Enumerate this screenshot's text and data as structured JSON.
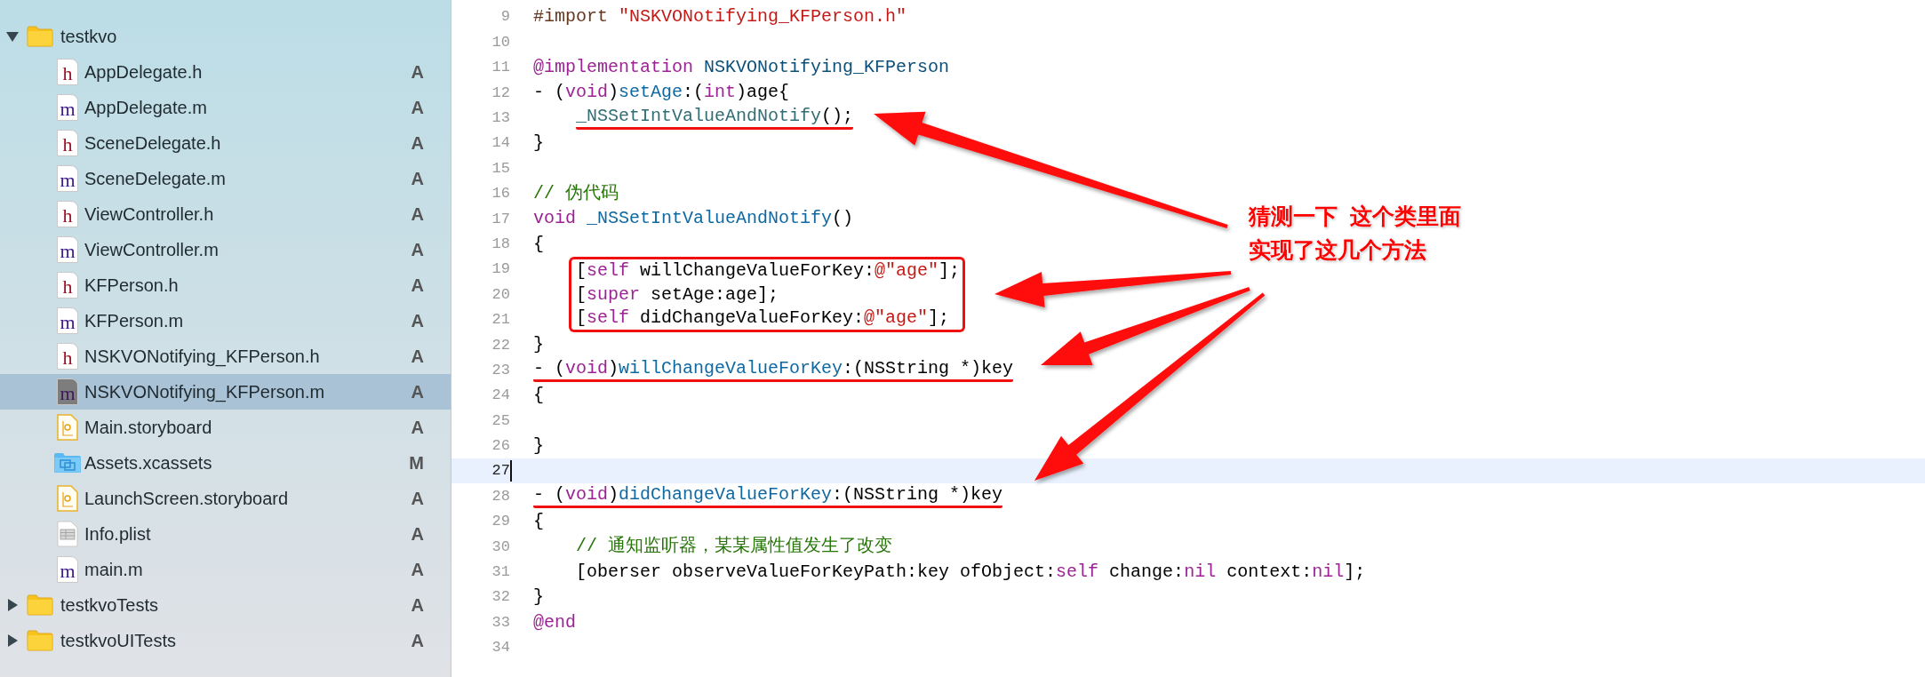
{
  "sidebar": {
    "items": [
      {
        "kind": "folder",
        "name": "testkvo",
        "expanded": true,
        "selected": false,
        "children": [
          {
            "kind": "header",
            "icon_text": "h",
            "name": "AppDelegate.h",
            "badge": "A",
            "selected": false
          },
          {
            "kind": "source",
            "icon_text": "m",
            "name": "AppDelegate.m",
            "badge": "A",
            "selected": false
          },
          {
            "kind": "header",
            "icon_text": "h",
            "name": "SceneDelegate.h",
            "badge": "A",
            "selected": false
          },
          {
            "kind": "source",
            "icon_text": "m",
            "name": "SceneDelegate.m",
            "badge": "A",
            "selected": false
          },
          {
            "kind": "header",
            "icon_text": "h",
            "name": "ViewController.h",
            "badge": "A",
            "selected": false
          },
          {
            "kind": "source",
            "icon_text": "m",
            "name": "ViewController.m",
            "badge": "A",
            "selected": false
          },
          {
            "kind": "header",
            "icon_text": "h",
            "name": "KFPerson.h",
            "badge": "A",
            "selected": false
          },
          {
            "kind": "source",
            "icon_text": "m",
            "name": "KFPerson.m",
            "badge": "A",
            "selected": false
          },
          {
            "kind": "header",
            "icon_text": "h",
            "name": "NSKVONotifying_KFPerson.h",
            "badge": "A",
            "selected": false
          },
          {
            "kind": "source",
            "icon_text": "m",
            "name": "NSKVONotifying_KFPerson.m",
            "badge": "A",
            "selected": true
          },
          {
            "kind": "storyboard",
            "name": "Main.storyboard",
            "badge": "A",
            "selected": false
          },
          {
            "kind": "assets",
            "name": "Assets.xcassets",
            "badge": "M",
            "selected": false
          },
          {
            "kind": "storyboard",
            "name": "LaunchScreen.storyboard",
            "badge": "A",
            "selected": false
          },
          {
            "kind": "plist",
            "name": "Info.plist",
            "badge": "A",
            "selected": false
          },
          {
            "kind": "source",
            "icon_text": "m",
            "name": "main.m",
            "badge": "A",
            "selected": false
          }
        ]
      },
      {
        "kind": "folder",
        "name": "testkvoTests",
        "badge": "A",
        "expanded": false,
        "selected": false
      },
      {
        "kind": "folder",
        "name": "testkvoUITests",
        "badge": "A",
        "expanded": false,
        "selected": false
      }
    ]
  },
  "editor": {
    "lines": [
      {
        "number": "9",
        "current": false,
        "indented": false,
        "tokens": [
          {
            "kind": "directive",
            "text": "#import "
          },
          {
            "kind": "string",
            "text": "\"NSKVONotifying_KFPerson.h\""
          }
        ]
      },
      {
        "number": "10",
        "current": false
      },
      {
        "number": "11",
        "current": false,
        "indented": false,
        "tokens": [
          {
            "kind": "keyword",
            "text": "@implementation"
          },
          {
            "kind": "type",
            "text": " NSKVONotifying_KFPerson"
          }
        ]
      },
      {
        "number": "12",
        "current": false,
        "indented": false,
        "tokens": [
          {
            "kind": "plain",
            "text": "- ("
          },
          {
            "kind": "keyword",
            "text": "void"
          },
          {
            "kind": "plain",
            "text": ")"
          },
          {
            "kind": "decl",
            "text": "setAge"
          },
          {
            "kind": "plain",
            "text": ":("
          },
          {
            "kind": "keyword",
            "text": "int"
          },
          {
            "kind": "plain",
            "text": ")age{"
          }
        ]
      },
      {
        "number": "13",
        "current": false,
        "indented": true,
        "kind": "underlined",
        "tokens": [
          {
            "kind": "call",
            "text": "_NSSetIntValueAndNotify"
          },
          {
            "kind": "plain",
            "text": "();"
          }
        ]
      },
      {
        "number": "14",
        "current": false,
        "indented": false,
        "tokens": [
          {
            "kind": "plain",
            "text": "}"
          }
        ]
      },
      {
        "number": "15",
        "current": false
      },
      {
        "number": "16",
        "current": false,
        "indented": false,
        "tokens": [
          {
            "kind": "comment",
            "text": "// 伪代码"
          }
        ]
      },
      {
        "number": "17",
        "current": false,
        "indented": false,
        "tokens": [
          {
            "kind": "keyword",
            "text": "void"
          },
          {
            "kind": "decl",
            "text": " _NSSetIntValueAndNotify"
          },
          {
            "kind": "plain",
            "text": "()"
          }
        ]
      },
      {
        "number": "18",
        "current": false,
        "indented": false,
        "tokens": [
          {
            "kind": "plain",
            "text": "{"
          }
        ]
      },
      {
        "number": "19",
        "current": false,
        "indented": true,
        "kind": "boxed",
        "tokens": [
          {
            "kind": "plain",
            "text": "["
          },
          {
            "kind": "keyword",
            "text": "self"
          },
          {
            "kind": "plain",
            "text": " willChangeValueForKey:"
          },
          {
            "kind": "string",
            "text": "@\"age\""
          },
          {
            "kind": "plain",
            "text": "];"
          }
        ]
      },
      {
        "number": "20",
        "current": false,
        "indented": true,
        "kind": "boxed",
        "tokens": [
          {
            "kind": "plain",
            "text": "["
          },
          {
            "kind": "keyword",
            "text": "super"
          },
          {
            "kind": "plain",
            "text": " setAge:age];"
          }
        ]
      },
      {
        "number": "21",
        "current": false,
        "indented": true,
        "kind": "boxed",
        "tokens": [
          {
            "kind": "plain",
            "text": "["
          },
          {
            "kind": "keyword",
            "text": "self"
          },
          {
            "kind": "plain",
            "text": " didChangeValueForKey:"
          },
          {
            "kind": "string",
            "text": "@\"age\""
          },
          {
            "kind": "plain",
            "text": "];"
          }
        ]
      },
      {
        "number": "22",
        "current": false,
        "indented": false,
        "tokens": [
          {
            "kind": "plain",
            "text": "}"
          }
        ]
      },
      {
        "number": "23",
        "current": false,
        "indented": false,
        "kind": "underlined",
        "tokens": [
          {
            "kind": "plain",
            "text": "- ("
          },
          {
            "kind": "keyword",
            "text": "void"
          },
          {
            "kind": "plain",
            "text": ")"
          },
          {
            "kind": "decl",
            "text": "willChangeValueForKey"
          },
          {
            "kind": "plain",
            "text": ":(NSString *)key"
          }
        ]
      },
      {
        "number": "24",
        "current": false,
        "indented": false,
        "tokens": [
          {
            "kind": "plain",
            "text": "{"
          }
        ]
      },
      {
        "number": "25",
        "current": false
      },
      {
        "number": "26",
        "current": false,
        "indented": false,
        "tokens": [
          {
            "kind": "plain",
            "text": "}"
          }
        ]
      },
      {
        "number": "27",
        "current": true
      },
      {
        "number": "28",
        "current": false,
        "indented": false,
        "kind": "underlined",
        "tokens": [
          {
            "kind": "plain",
            "text": "- ("
          },
          {
            "kind": "keyword",
            "text": "void"
          },
          {
            "kind": "plain",
            "text": ")"
          },
          {
            "kind": "decl",
            "text": "didChangeValueForKey"
          },
          {
            "kind": "plain",
            "text": ":(NSString *)key"
          }
        ]
      },
      {
        "number": "29",
        "current": false,
        "indented": false,
        "tokens": [
          {
            "kind": "plain",
            "text": "{"
          }
        ]
      },
      {
        "number": "30",
        "current": false,
        "indented": true,
        "tokens": [
          {
            "kind": "comment",
            "text": "// 通知监听器，某某属性值发生了改变"
          }
        ]
      },
      {
        "number": "31",
        "current": false,
        "indented": true,
        "tokens": [
          {
            "kind": "plain",
            "text": "[oberser observeValueForKeyPath:key ofObject:"
          },
          {
            "kind": "keyword",
            "text": "self"
          },
          {
            "kind": "plain",
            "text": " change:"
          },
          {
            "kind": "keyword",
            "text": "nil"
          },
          {
            "kind": "plain",
            "text": " context:"
          },
          {
            "kind": "keyword",
            "text": "nil"
          },
          {
            "kind": "plain",
            "text": "];"
          }
        ]
      },
      {
        "number": "32",
        "current": false,
        "indented": false,
        "tokens": [
          {
            "kind": "plain",
            "text": "}"
          }
        ]
      },
      {
        "number": "33",
        "current": false,
        "indented": false,
        "tokens": [
          {
            "kind": "keyword",
            "text": "@end"
          }
        ]
      },
      {
        "number": "34",
        "current": false
      }
    ],
    "callout": {
      "lines": [
        "猜测一下  这个类里面",
        "实现了这几个方法"
      ]
    }
  }
}
